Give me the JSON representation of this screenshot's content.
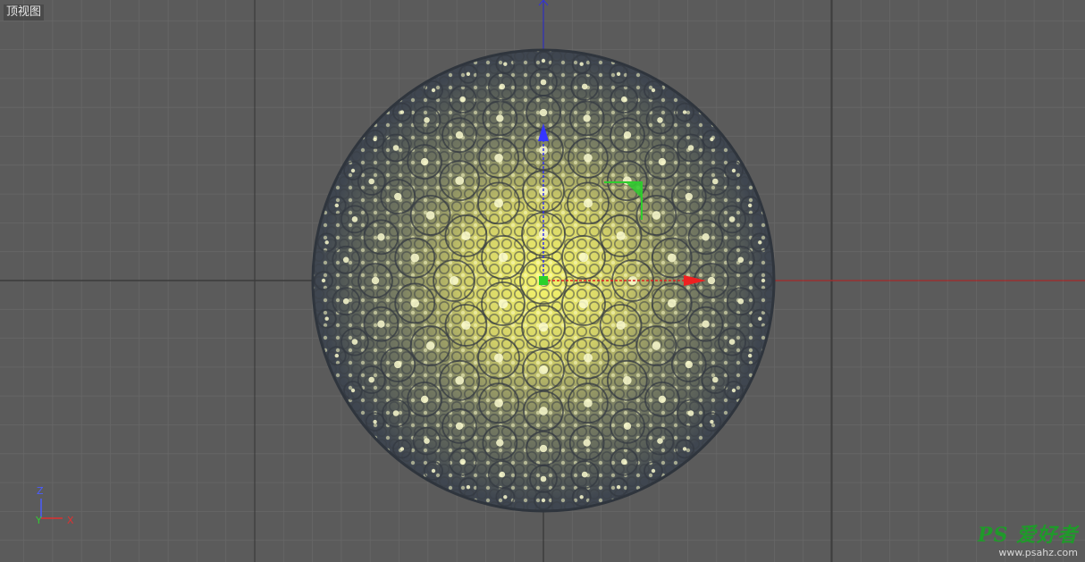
{
  "viewport": {
    "view_label": "顶视图",
    "background_color": "#5b5b5b",
    "grid_color": "#676767",
    "grid_major_color": "#3f3f3f"
  },
  "axes_indicator": {
    "z_label": "Z",
    "y_label": "Y",
    "x_label": "X",
    "z_color": "#4a5cff",
    "y_color": "#33cc33",
    "x_color": "#e03030"
  },
  "object": {
    "type": "sphere",
    "shell_color": "#3f4650",
    "highlight_color": "#f2f36a"
  },
  "gizmo": {
    "x_color": "#e02020",
    "y_color": "#2ecc2e",
    "z_color": "#3333ee",
    "pivot_color": "#2ad12a"
  },
  "watermark": {
    "logo": "PS 爱好者",
    "url": "www.psahz.com"
  }
}
